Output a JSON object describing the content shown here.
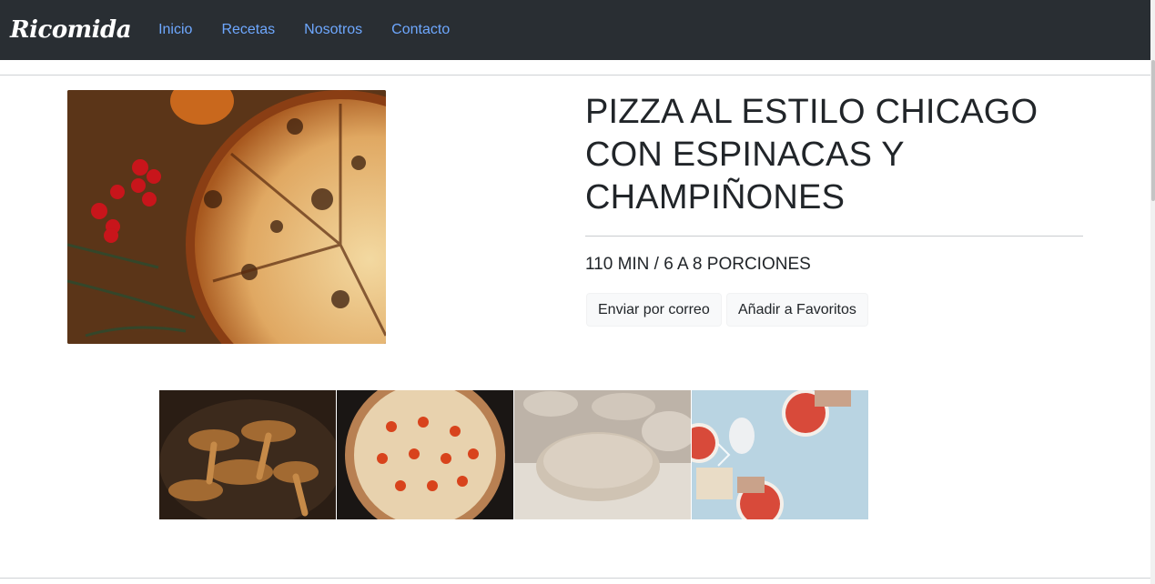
{
  "navbar": {
    "brand": "Ricomida",
    "links": [
      "Inicio",
      "Recetas",
      "Nosotros",
      "Contacto"
    ],
    "link_color": "#6ea8ff",
    "background": "#292e33"
  },
  "hero_image": {
    "icon": "pizza-photo"
  },
  "recipe": {
    "title": "PIZZA AL ESTILO CHICAGO CON ESPINACAS Y CHAMPIÑONES",
    "meta": "110 MIN / 6 A 8 PORCIONES",
    "buttons": {
      "email": "Enviar por correo",
      "favorite": "Añadir a Favoritos"
    }
  },
  "gallery": {
    "items": [
      {
        "icon": "mushrooms-photo"
      },
      {
        "icon": "tomato-pizza-photo"
      },
      {
        "icon": "dough-photo"
      },
      {
        "icon": "pizza-making-photo"
      }
    ],
    "next_icon": "chevron-right-icon"
  }
}
